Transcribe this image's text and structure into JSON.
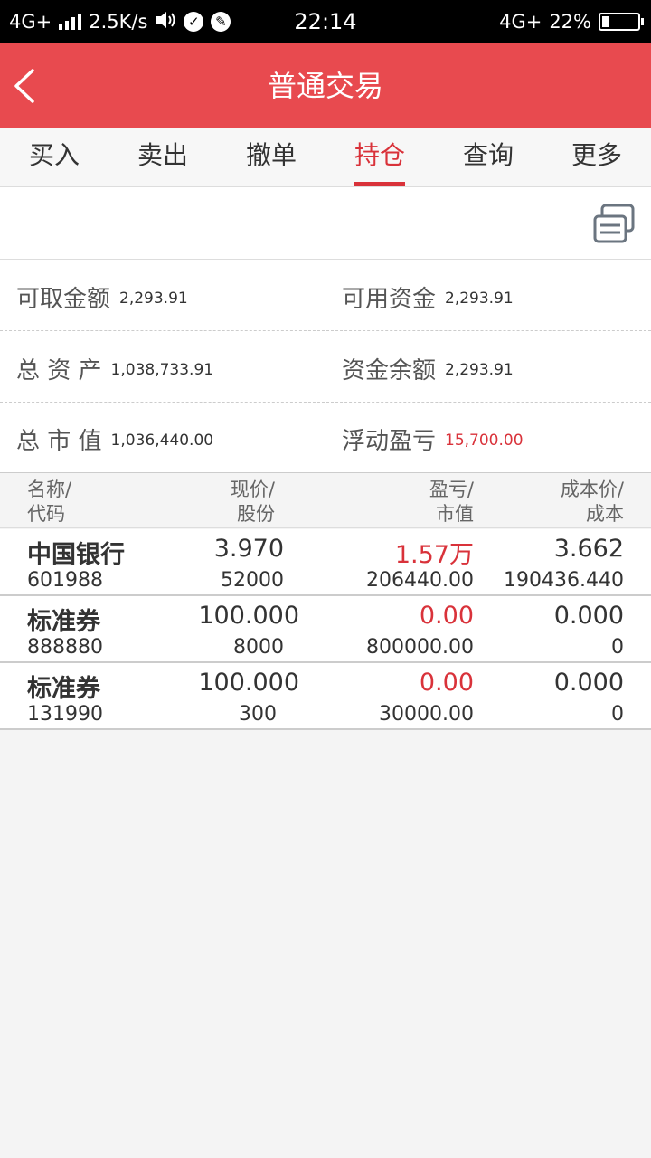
{
  "status_bar": {
    "network_left": "4G+",
    "speed": "2.5K/s",
    "time": "22:14",
    "network_right": "4G+",
    "battery_percent": "22%",
    "battery_level": 0.22
  },
  "header": {
    "title": "普通交易"
  },
  "tabs": [
    {
      "label": "买入"
    },
    {
      "label": "卖出"
    },
    {
      "label": "撤单"
    },
    {
      "label": "持仓",
      "active": true
    },
    {
      "label": "查询"
    },
    {
      "label": "更多"
    }
  ],
  "summary": {
    "withdrawable_label": "可取金额",
    "withdrawable_value": "2,293.91",
    "available_label": "可用资金",
    "available_value": "2,293.91",
    "total_assets_label": "总 资 产",
    "total_assets_value": "1,038,733.91",
    "fund_balance_label": "资金余额",
    "fund_balance_value": "2,293.91",
    "market_value_label": "总 市 值",
    "market_value_value": "1,036,440.00",
    "floating_pl_label": "浮动盈亏",
    "floating_pl_value": "15,700.00"
  },
  "table": {
    "headers": {
      "name_1": "名称/",
      "name_2": "代码",
      "price_1": "现价/",
      "price_2": "股份",
      "pl_1": "盈亏/",
      "pl_2": "市值",
      "cost_1": "成本价/",
      "cost_2": "成本"
    },
    "rows": [
      {
        "name": "中国银行",
        "code": "601988",
        "price": "3.970",
        "shares": "52000",
        "pl": "1.57万",
        "market_value": "206440.00",
        "cost_price": "3.662",
        "cost": "190436.440"
      },
      {
        "name": "标准券",
        "code": "888880",
        "price": "100.000",
        "shares": "8000",
        "pl": "0.00",
        "market_value": "800000.00",
        "cost_price": "0.000",
        "cost": "0"
      },
      {
        "name": "标准券",
        "code": "131990",
        "price": "100.000",
        "shares": "300",
        "pl": "0.00",
        "market_value": "30000.00",
        "cost_price": "0.000",
        "cost": "0"
      }
    ]
  },
  "colors": {
    "header_bg": "#e84a4f",
    "accent_red": "#d9323a"
  },
  "icons": [
    "back-arrow-icon",
    "refresh-icon",
    "signal-icon",
    "volume-icon",
    "check-icon",
    "app-icon",
    "battery-icon"
  ]
}
